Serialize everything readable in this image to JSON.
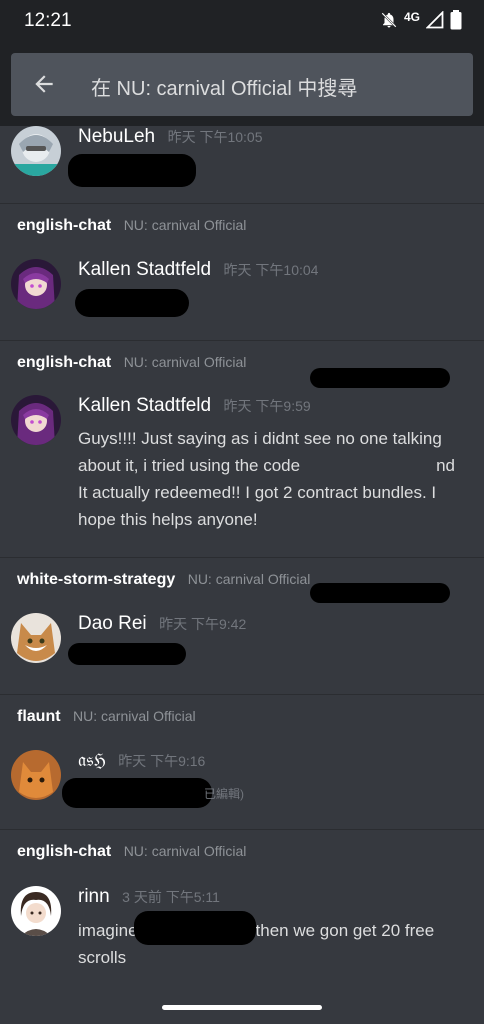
{
  "status_bar": {
    "time": "12:21",
    "network": "4G"
  },
  "search": {
    "query": "在 NU: carnival Official 中搜尋"
  },
  "results": [
    {
      "channel": "",
      "server": "",
      "author": "NebuLeh",
      "timestamp": "昨天 下午10:05",
      "content": ""
    },
    {
      "channel": "english-chat",
      "server": "NU: carnival Official",
      "author": "Kallen Stadtfeld",
      "timestamp": "昨天 下午10:04",
      "content": ""
    },
    {
      "channel": "english-chat",
      "server": "NU: carnival Official",
      "author": "Kallen Stadtfeld",
      "timestamp": "昨天 下午9:59",
      "content_parts": [
        "Guys!!!! Just saying as i didnt see no one talking about it, i tried using the code",
        "nd It actually redeemed!! I got 2 contract bundles. I hope this helps anyone!"
      ]
    },
    {
      "channel": "white-storm-strategy",
      "server": "NU: carnival Official",
      "author": "Dao Rei",
      "timestamp": "昨天 下午9:42",
      "content": ""
    },
    {
      "channel": "flaunt",
      "server": "NU: carnival Official",
      "author": "𝔞𝔰ℌ",
      "timestamp": "昨天 下午9:16",
      "edited": "已編輯)"
    },
    {
      "channel": "english-chat",
      "server": "NU: carnival Official",
      "author": "rinn",
      "timestamp": "3 天前 下午5:11",
      "content_parts": [
        "imagine",
        "then we gon get 20 free scrolls"
      ]
    }
  ]
}
